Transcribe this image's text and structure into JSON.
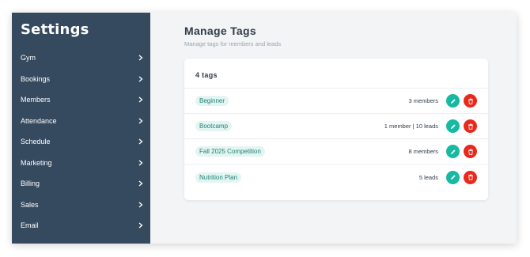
{
  "sidebar": {
    "title": "Settings",
    "items": [
      {
        "label": "Gym"
      },
      {
        "label": "Bookings"
      },
      {
        "label": "Members"
      },
      {
        "label": "Attendance"
      },
      {
        "label": "Schedule"
      },
      {
        "label": "Marketing"
      },
      {
        "label": "Billing"
      },
      {
        "label": "Sales"
      },
      {
        "label": "Email"
      }
    ]
  },
  "main": {
    "title": "Manage Tags",
    "subtitle": "Manage tags for members and leads",
    "card": {
      "header": "4 tags",
      "rows": [
        {
          "tag": "Beginner",
          "count": "3 members"
        },
        {
          "tag": "Bootcamp",
          "count": "1 member | 10 leads"
        },
        {
          "tag": "Fall 2025 Competition",
          "count": "8 members"
        },
        {
          "tag": "Nutrition Plan",
          "count": "5 leads"
        }
      ]
    }
  },
  "colors": {
    "sidebar_bg": "#364a5f",
    "tag_bg": "#e3f5f2",
    "tag_text": "#1f7f73",
    "edit_button": "#17b9a2",
    "delete_button": "#e8291c"
  },
  "icons": {
    "nav_item": "chevron-right-icon",
    "edit": "pencil-icon",
    "delete": "trash-icon"
  }
}
